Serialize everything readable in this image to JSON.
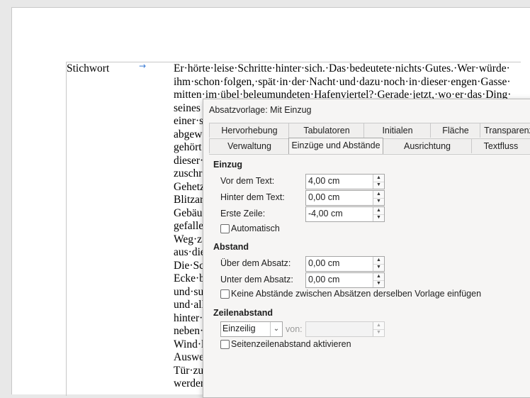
{
  "document": {
    "keyword": "Stichwort",
    "tab_arrow": "→",
    "lines": [
      "Er·hörte·leise·Schritte·hinter·sich.·Das·bedeutete·nichts·Gutes.·Wer·würde·",
      "ihm·schon·folgen,·spät·in·der·Nacht·und·dazu·noch·in·dieser·engen·Gasse·",
      "mitten·im·übel·beleumundeten·Hafenviertel?·Gerade·jetzt,·wo·er·das·Ding·",
      "seines",
      "einer·s",
      "abgew",
      "gehört",
      "dieser·",
      "zuschr",
      "Gehetz",
      "Blitzar",
      "Gebäu",
      "gefalle",
      "Weg·z",
      "aus·die",
      "Die·Sc",
      "Ecke·b",
      "und·su",
      "und·all",
      "hinter·",
      "neben·",
      "Wind·l",
      "Auswe",
      "Tür·zu",
      "werder"
    ]
  },
  "dialog": {
    "title": "Absatzvorlage: Mit Einzug",
    "tabs_row1": [
      "Hervorhebung",
      "Tabulatoren",
      "Initialen",
      "Fläche",
      "Transparenz"
    ],
    "tabs_row2": [
      "Verwaltung",
      "Einzüge und Abstände",
      "Ausrichtung",
      "Textfluss"
    ],
    "active_tab": "Einzüge und Abstände",
    "indent": {
      "heading": "Einzug",
      "before_text": {
        "label": "Vor dem Text:",
        "value": "4,00 cm"
      },
      "after_text": {
        "label": "Hinter dem Text:",
        "value": "0,00 cm"
      },
      "first_line": {
        "label": "Erste Zeile:",
        "value": "-4,00 cm"
      },
      "automatic": {
        "label": "Automatisch",
        "checked": false
      }
    },
    "spacing": {
      "heading": "Abstand",
      "above": {
        "label": "Über dem Absatz:",
        "value": "0,00 cm"
      },
      "below": {
        "label": "Unter dem Absatz:",
        "value": "0,00 cm"
      },
      "no_space": {
        "label": "Keine Abstände zwischen Absätzen derselben Vorlage einfügen",
        "checked": false
      }
    },
    "line_spacing": {
      "heading": "Zeilenabstand",
      "selected": "Einzeilig",
      "of_label": "von:",
      "of_value": "",
      "register": {
        "label": "Seitenzeilenabstand aktivieren",
        "checked": false
      }
    }
  }
}
